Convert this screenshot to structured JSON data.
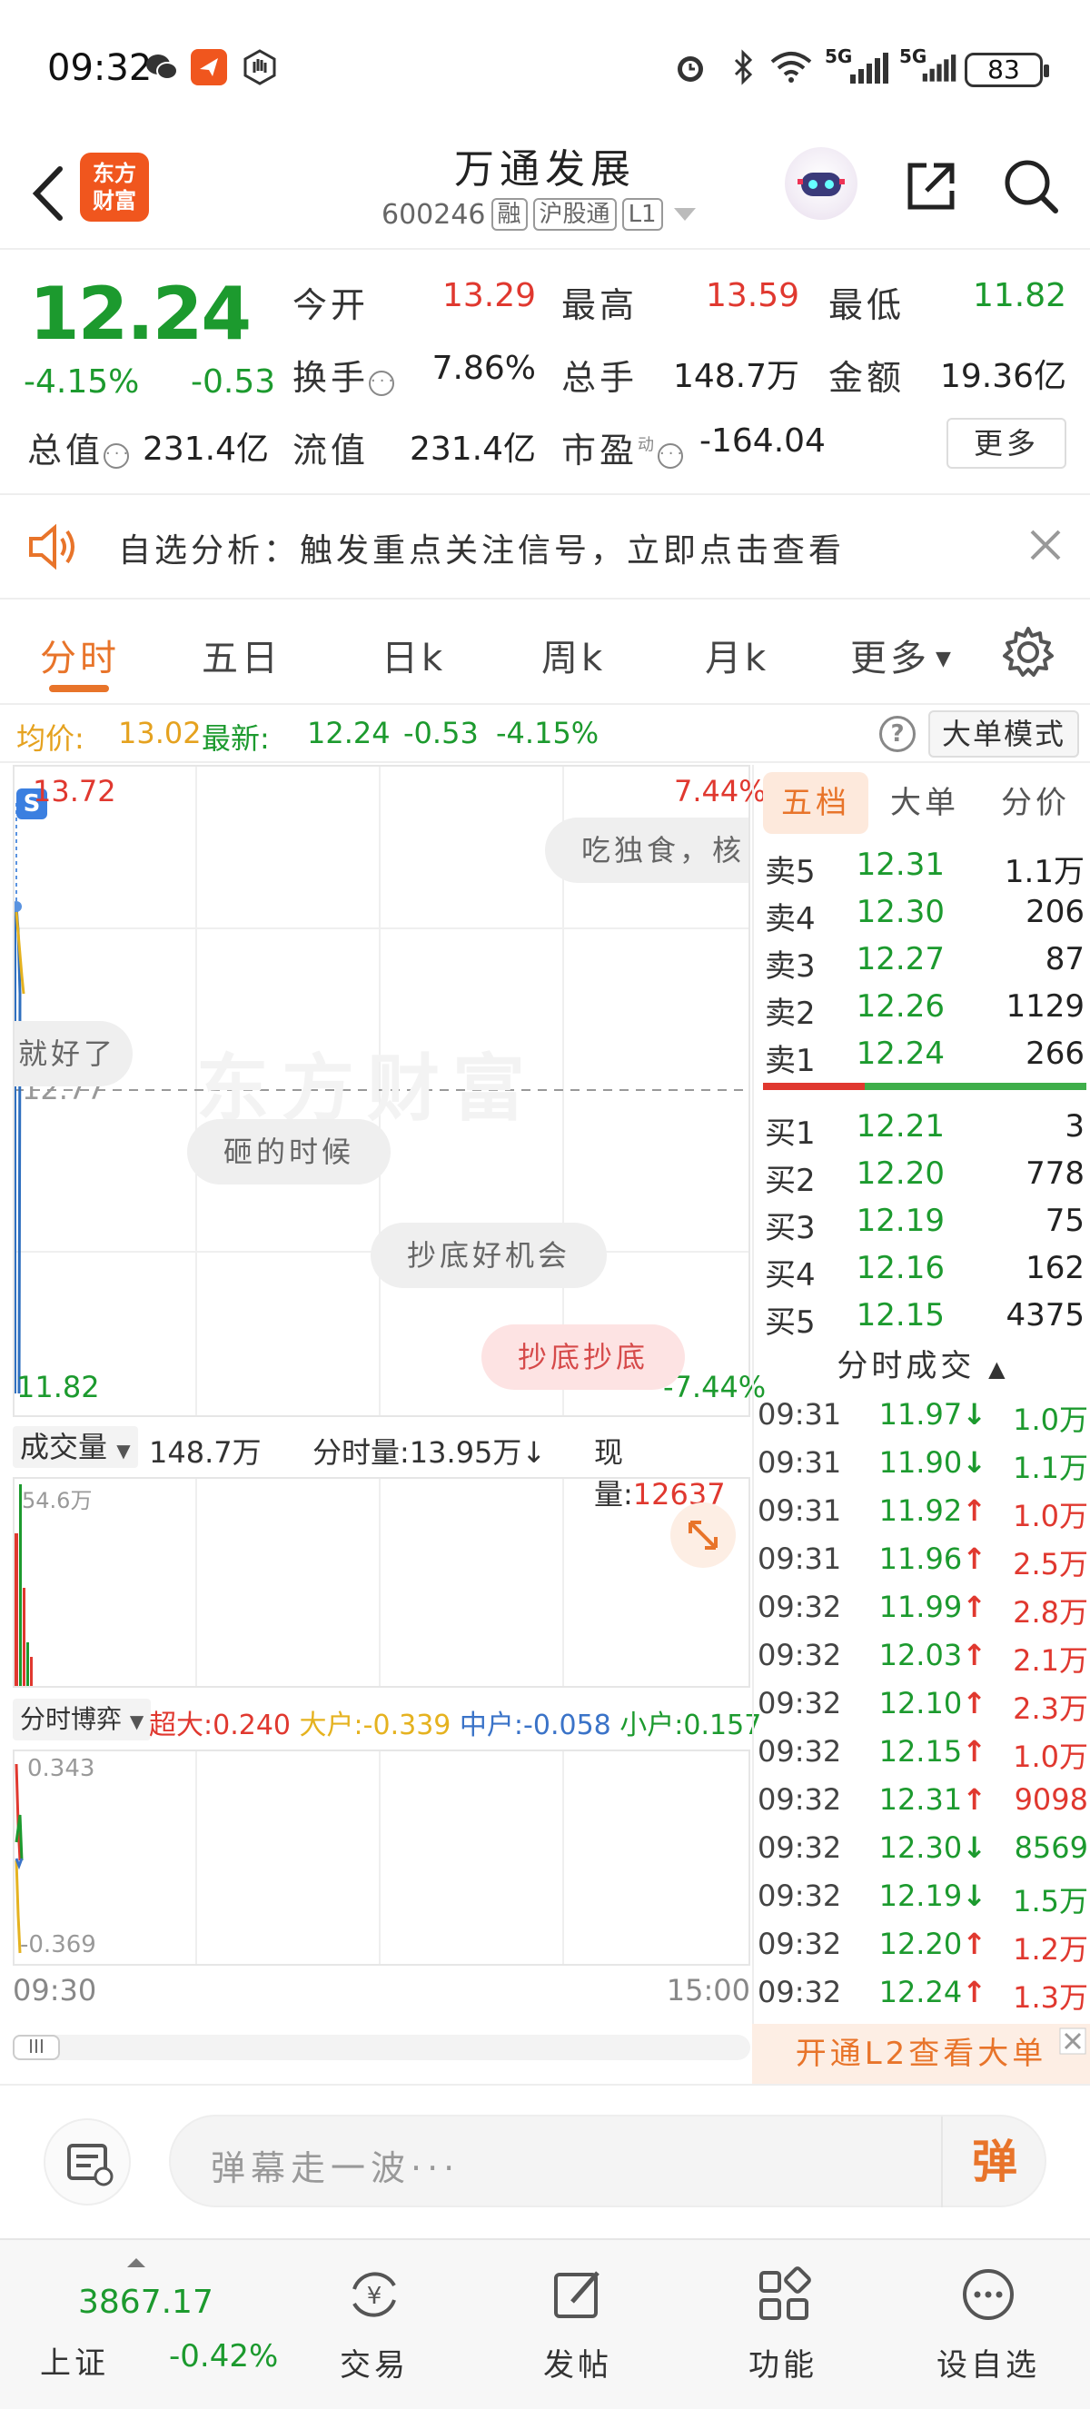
{
  "status": {
    "time": "09:32",
    "battery": "83",
    "net1": "5G",
    "net2": "5G"
  },
  "header": {
    "logo_line1": "东方",
    "logo_line2": "财富",
    "stock_name": "万通发展",
    "stock_code": "600246",
    "tags": [
      "融",
      "沪股通",
      "L1"
    ]
  },
  "quote": {
    "price": "12.24",
    "change_pct": "-4.15%",
    "change_abs": "-0.53",
    "fields": [
      {
        "label": "今开",
        "value": "13.29",
        "color": "#e0382f"
      },
      {
        "label": "最高",
        "value": "13.59",
        "color": "#e0382f"
      },
      {
        "label": "最低",
        "value": "11.82",
        "color": "#1c9a2e"
      },
      {
        "label": "换手",
        "value": "7.86%",
        "color": "#222222"
      },
      {
        "label": "总手",
        "value": "148.7万",
        "color": "#222222"
      },
      {
        "label": "金额",
        "value": "19.36亿",
        "color": "#222222"
      },
      {
        "label": "总值",
        "value": "231.4亿",
        "color": "#222222"
      },
      {
        "label": "流值",
        "value": "231.4亿",
        "color": "#222222"
      },
      {
        "label": "市盈",
        "value": "-164.04",
        "color": "#222222"
      }
    ],
    "pe_superscript": "动",
    "more_label": "更多"
  },
  "notice": {
    "text": "自选分析：触发重点关注信号，立即点击查看"
  },
  "tabs": {
    "items": [
      "分时",
      "五日",
      "日k",
      "周k",
      "月k",
      "更多"
    ],
    "active": 0
  },
  "avg_row": {
    "avg_label": "均价:",
    "avg_value": "13.02",
    "latest_label": "最新:",
    "latest_value": "12.24",
    "latest_chg": "-0.53",
    "latest_pct": "-4.15%",
    "mode_label": "大单模式"
  },
  "chart": {
    "watermark": "东方财富",
    "y_top": "13.72",
    "y_mid": "12.77",
    "y_bottom": "11.82",
    "pct_top": "7.44%",
    "pct_bottom": "-7.44%",
    "badge": "S",
    "bubbles": [
      "吃独食，核",
      "就好了",
      "砸的时候",
      "抄底好机会",
      "抄底抄底"
    ]
  },
  "volume": {
    "label": "成交量",
    "total": "148.7万",
    "minute_label": "分时量:",
    "minute_value": "13.95万",
    "current_label": "现量:",
    "current_value": "12637",
    "y_max": "54.6万"
  },
  "game": {
    "label": "分时博弈",
    "items": [
      {
        "name": "超大:",
        "value": "0.240",
        "color": "#e0382f"
      },
      {
        "name": "大户:",
        "value": "-0.339",
        "color": "#e5b21f"
      },
      {
        "name": "中户:",
        "value": "-0.058",
        "color": "#3a73c8"
      },
      {
        "name": "小户:",
        "value": "0.157",
        "color": "#1c9a2e"
      }
    ],
    "y_top": "0.343",
    "y_bottom": "-0.369"
  },
  "time_axis": {
    "start": "09:30",
    "end": "15:00"
  },
  "order_book": {
    "tabs": [
      "五档",
      "大单",
      "分价"
    ],
    "asks": [
      {
        "label": "卖5",
        "price": "12.31",
        "vol": "1.1万"
      },
      {
        "label": "卖4",
        "price": "12.30",
        "vol": "206"
      },
      {
        "label": "卖3",
        "price": "12.27",
        "vol": "87"
      },
      {
        "label": "卖2",
        "price": "12.26",
        "vol": "1129"
      },
      {
        "label": "卖1",
        "price": "12.24",
        "vol": "266"
      }
    ],
    "bids": [
      {
        "label": "买1",
        "price": "12.21",
        "vol": "3"
      },
      {
        "label": "买2",
        "price": "12.20",
        "vol": "778"
      },
      {
        "label": "买3",
        "price": "12.19",
        "vol": "75"
      },
      {
        "label": "买4",
        "price": "12.16",
        "vol": "162"
      },
      {
        "label": "买5",
        "price": "12.15",
        "vol": "4375"
      }
    ]
  },
  "ticks": {
    "title": "分时成交",
    "rows": [
      {
        "time": "09:31",
        "price": "11.97",
        "dir": "down",
        "vol": "1.0万"
      },
      {
        "time": "09:31",
        "price": "11.90",
        "dir": "down",
        "vol": "1.1万"
      },
      {
        "time": "09:31",
        "price": "11.92",
        "dir": "up",
        "vol": "1.0万"
      },
      {
        "time": "09:31",
        "price": "11.96",
        "dir": "up",
        "vol": "2.5万"
      },
      {
        "time": "09:32",
        "price": "11.99",
        "dir": "up",
        "vol": "2.8万"
      },
      {
        "time": "09:32",
        "price": "12.03",
        "dir": "up",
        "vol": "2.1万"
      },
      {
        "time": "09:32",
        "price": "12.10",
        "dir": "up",
        "vol": "2.3万"
      },
      {
        "time": "09:32",
        "price": "12.15",
        "dir": "up",
        "vol": "1.0万"
      },
      {
        "time": "09:32",
        "price": "12.31",
        "dir": "up",
        "vol": "9098"
      },
      {
        "time": "09:32",
        "price": "12.30",
        "dir": "down",
        "vol": "8569"
      },
      {
        "time": "09:32",
        "price": "12.19",
        "dir": "down",
        "vol": "1.5万"
      },
      {
        "time": "09:32",
        "price": "12.20",
        "dir": "up",
        "vol": "1.2万"
      },
      {
        "time": "09:32",
        "price": "12.24",
        "dir": "up",
        "vol": "1.3万"
      }
    ],
    "banner": "开通L2查看大单"
  },
  "comment": {
    "placeholder": "弹幕走一波···",
    "danmu_label": "弹"
  },
  "bottom_nav": {
    "index_value": "3867.17",
    "index_name": "上证",
    "index_change": "-0.42%",
    "items": [
      "交易",
      "发帖",
      "功能",
      "设自选"
    ]
  },
  "colors": {
    "up": "#e0382f",
    "down": "#1c9a2e",
    "accent": "#e8742a"
  }
}
